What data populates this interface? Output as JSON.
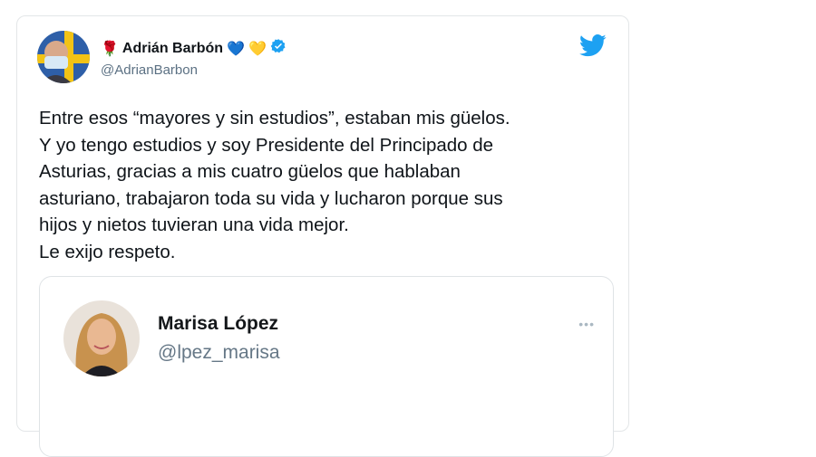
{
  "tweet": {
    "author_name": "Adrián Barbón",
    "handle": "@AdrianBarbon",
    "emoji_rose": "🌹",
    "emoji_hearts": [
      "💙",
      "💛"
    ],
    "verified_icon": "verified-badge-icon",
    "platform_icon": "twitter-bird-icon",
    "text_lines": [
      "Entre esos “mayores y sin estudios”, estaban mis güelos.",
      "Y yo tengo estudios y soy Presidente del Principado de",
      "Asturias, gracias a mis cuatro güelos que hablaban",
      "asturiano, trabajaron toda su vida y lucharon porque sus",
      "hijos y nietos tuvieran una vida mejor.",
      "Le exijo respeto."
    ]
  },
  "quoted": {
    "author_name": "Marisa López",
    "handle": "@lpez_marisa",
    "more_label": "•••"
  },
  "colors": {
    "twitter_blue": "#1da1f2",
    "text": "#0f1419",
    "muted": "#5b7083",
    "border": "#e3e6e8"
  }
}
